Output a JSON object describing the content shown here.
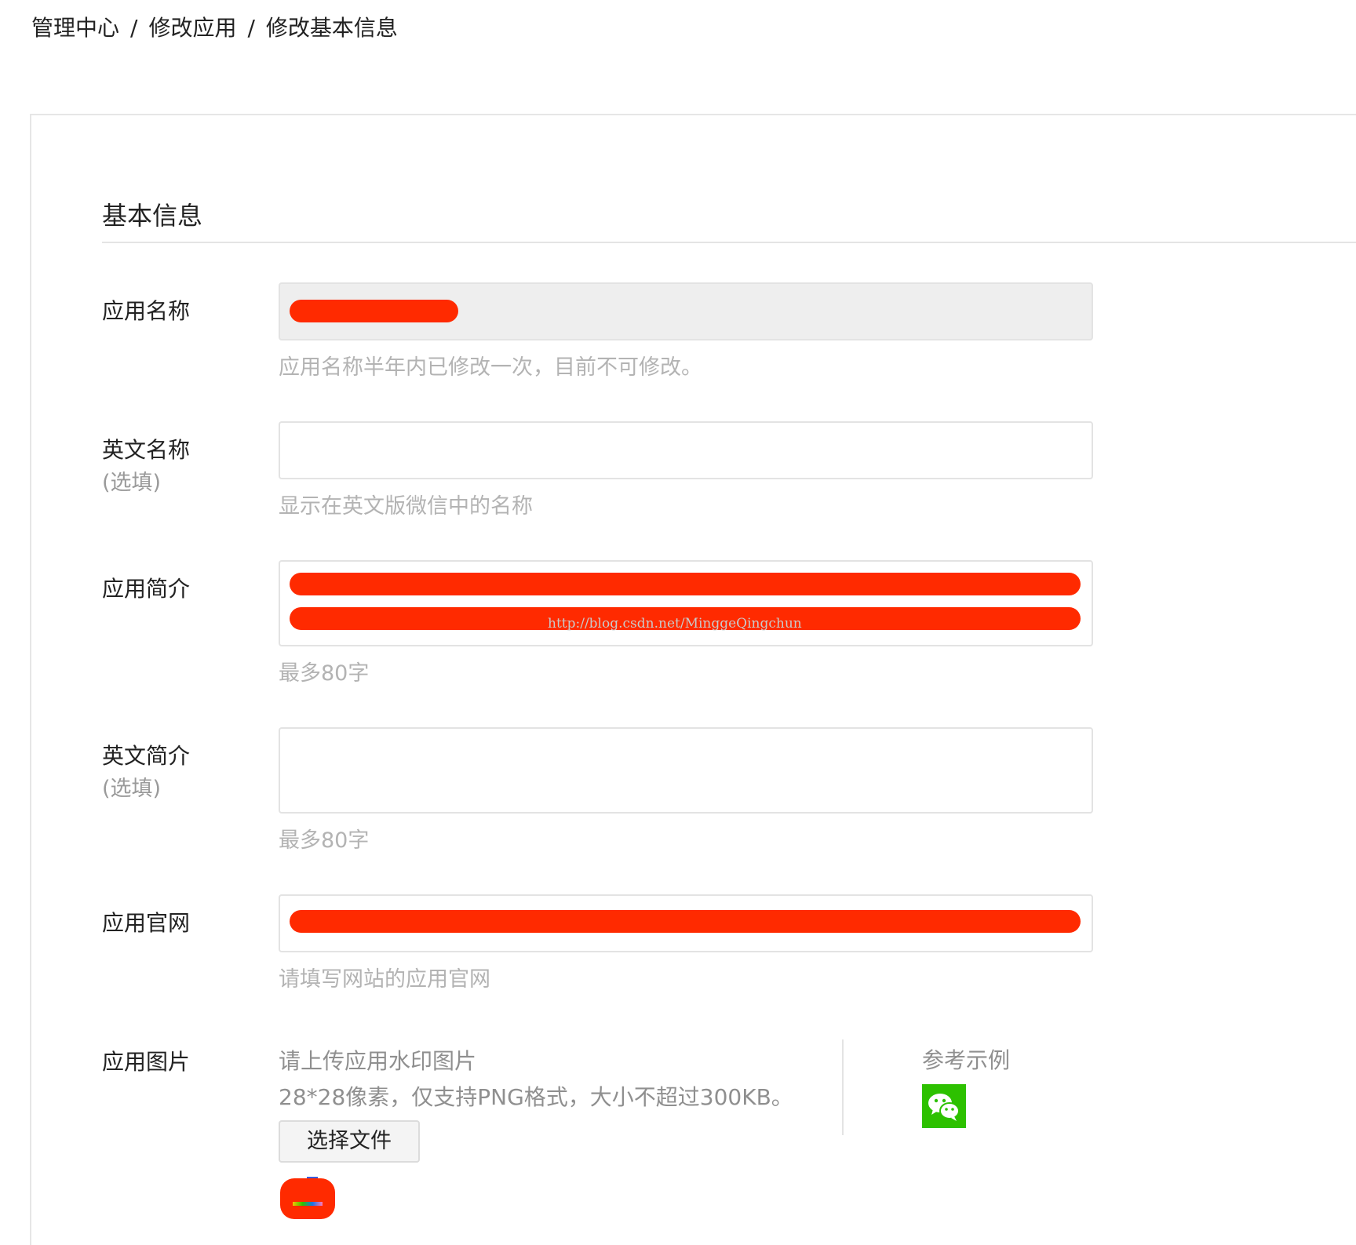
{
  "breadcrumb": {
    "items": [
      "管理中心",
      "修改应用",
      "修改基本信息"
    ],
    "separator": "/"
  },
  "section": {
    "title": "基本信息"
  },
  "form": {
    "app_name": {
      "label": "应用名称",
      "value": "",
      "hint": "应用名称半年内已修改一次，目前不可修改。"
    },
    "english_name": {
      "label": "英文名称",
      "optional": "(选填)",
      "value": "",
      "hint": "显示在英文版微信中的名称"
    },
    "app_intro": {
      "label": "应用简介",
      "value": "",
      "hint": "最多80字"
    },
    "english_intro": {
      "label": "英文简介",
      "optional": "(选填)",
      "value": "",
      "hint": "最多80字"
    },
    "website": {
      "label": "应用官网",
      "value": "",
      "hint": "请填写网站的应用官网"
    },
    "image": {
      "label": "应用图片",
      "info_line1": "请上传应用水印图片",
      "info_line2": "28*28像素，仅支持PNG格式，大小不超过300KB。",
      "choose_file": "选择文件",
      "reference_title": "参考示例",
      "reference_icon": "wechat-icon"
    }
  },
  "watermark": "http://blog.csdn.net/MinggeQingchun",
  "colors": {
    "redaction": "#ff2a00",
    "wechat_green": "#2dc100",
    "hint_gray": "#b3b3b3"
  }
}
